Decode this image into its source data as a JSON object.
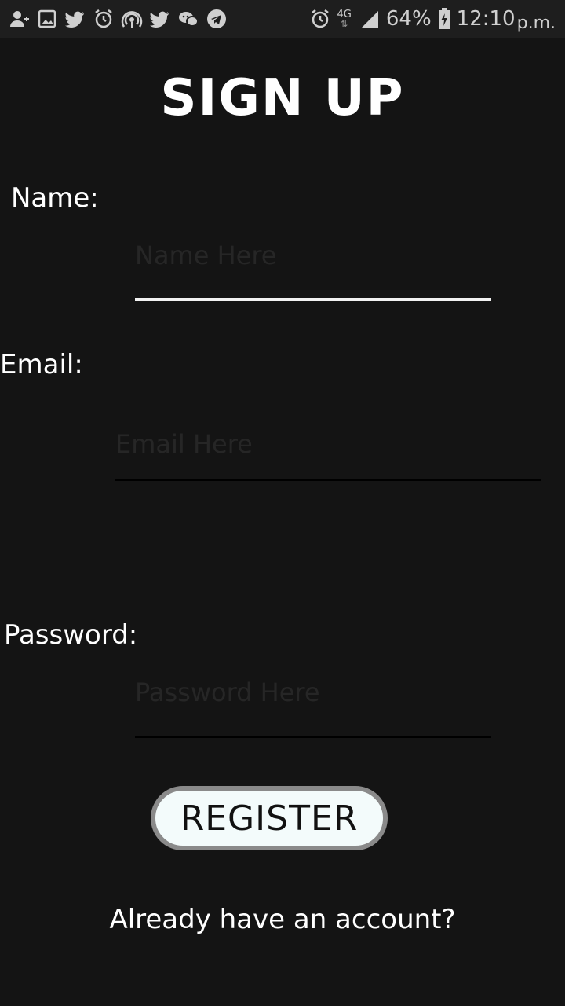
{
  "status_bar": {
    "left_icons": [
      "add-contact-icon",
      "gallery-icon",
      "twitter-icon",
      "alarm-icon",
      "hotspot-icon",
      "twitter-icon",
      "chat-icon",
      "telegram-icon"
    ],
    "right_icons": [
      "alarm-icon",
      "network-4g-icon",
      "signal-icon",
      "battery-charging-icon"
    ],
    "network_type": "4G",
    "battery": "64%",
    "time": "12:10",
    "ampm": "p.m."
  },
  "form": {
    "title": "SIGN UP",
    "name_label": "Name:",
    "name_placeholder": "Name Here",
    "email_label": "Email:",
    "email_placeholder": "Email Here",
    "password_label": "Password:",
    "password_placeholder": "Password Here",
    "register_label": "REGISTER",
    "login_link": "Already have an account?"
  }
}
